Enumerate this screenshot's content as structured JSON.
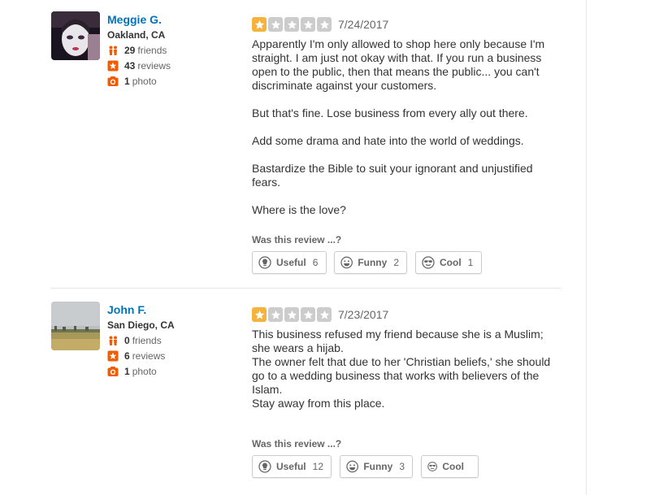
{
  "colors": {
    "accent": "#0073bb",
    "star_filled": "#f5b33d",
    "star_empty": "#cccccc",
    "stat_icon": "#f15c00"
  },
  "reviews": [
    {
      "user": {
        "name": "Meggie G.",
        "location": "Oakland, CA",
        "friends_count": "29",
        "friends_label": "friends",
        "reviews_count": "43",
        "reviews_label": "reviews",
        "photos_count": "1",
        "photos_label": "photo"
      },
      "rating": 1,
      "date": "7/24/2017",
      "paragraphs": [
        "Apparently I'm only allowed to shop here only because I'm straight. I am just not okay with that. If you run a business open to the public, then that means the public... you can't discriminate against your customers.",
        "But that's fine. Lose business from every ally out there.",
        "Add some drama and hate into the world of weddings.",
        "Bastardize the Bible to suit your ignorant and unjustified fears.",
        "Where is the love?"
      ],
      "was_this_review": "Was this review ...?",
      "votes": {
        "useful_label": "Useful",
        "useful_count": "6",
        "funny_label": "Funny",
        "funny_count": "2",
        "cool_label": "Cool",
        "cool_count": "1"
      }
    },
    {
      "user": {
        "name": "John F.",
        "location": "San Diego, CA",
        "friends_count": "0",
        "friends_label": "friends",
        "reviews_count": "6",
        "reviews_label": "reviews",
        "photos_count": "1",
        "photos_label": "photo"
      },
      "rating": 1,
      "date": "7/23/2017",
      "lines": [
        "This business refused my friend because she is a Muslim; she wears a hijab.",
        "The owner felt that due to her 'Christian beliefs,' she should go to a wedding business that works with believers of the Islam.",
        "Stay away from this place."
      ],
      "was_this_review": "Was this review ...?",
      "votes": {
        "useful_label": "Useful",
        "useful_count": "12",
        "funny_label": "Funny",
        "funny_count": "3",
        "cool_label": "Cool",
        "cool_count": ""
      }
    }
  ]
}
